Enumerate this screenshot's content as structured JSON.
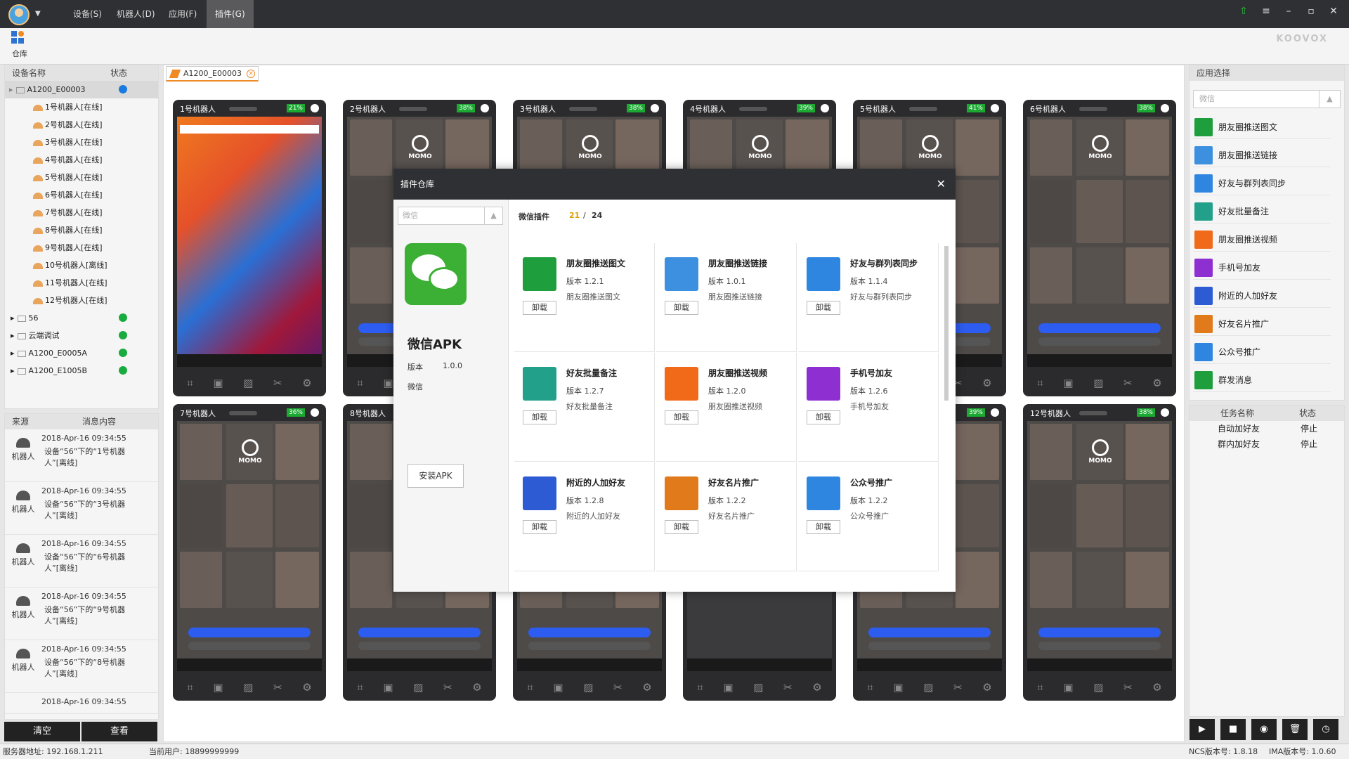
{
  "menu": [
    "设备(S)",
    "机器人(D)",
    "应用(F)",
    "插件(G)"
  ],
  "warehouse_label": "仓库",
  "brand": "KOOVOX",
  "device_panel": {
    "col_name": "设备名称",
    "col_status": "状态",
    "root": "A1200_E00003",
    "robots": [
      "1号机器人[在线]",
      "2号机器人[在线]",
      "3号机器人[在线]",
      "4号机器人[在线]",
      "5号机器人[在线]",
      "6号机器人[在线]",
      "7号机器人[在线]",
      "8号机器人[在线]",
      "9号机器人[在线]",
      "10号机器人[离线]",
      "11号机器人[在线]",
      "12号机器人[在线]"
    ],
    "groups": [
      "56",
      "云端调试",
      "A1200_E0005A",
      "A1200_E1005B"
    ]
  },
  "msg_panel": {
    "col_src": "来源",
    "col_msg": "消息内容",
    "items": [
      {
        "src": "机器人",
        "time": "2018-Apr-16 09:34:55",
        "body": "设备“56”下的“1号机器人”[离线]"
      },
      {
        "src": "机器人",
        "time": "2018-Apr-16 09:34:55",
        "body": "设备“56”下的“3号机器人”[离线]"
      },
      {
        "src": "机器人",
        "time": "2018-Apr-16 09:34:55",
        "body": "设备“56”下的“6号机器人”[离线]"
      },
      {
        "src": "机器人",
        "time": "2018-Apr-16 09:34:55",
        "body": "设备“56”下的“9号机器人”[离线]"
      },
      {
        "src": "机器人",
        "time": "2018-Apr-16 09:34:55",
        "body": "设备“56”下的“8号机器人”[离线]"
      },
      {
        "src": "",
        "time": "2018-Apr-16 09:34:55",
        "body": ""
      }
    ],
    "btn_clear": "清空",
    "btn_view": "查看"
  },
  "center_tab": "A1200_E00003",
  "phones": [
    {
      "name": "1号机器人",
      "batt": "21%"
    },
    {
      "name": "2号机器人",
      "batt": "38%"
    },
    {
      "name": "3号机器人",
      "batt": "38%"
    },
    {
      "name": "4号机器人",
      "batt": "39%"
    },
    {
      "name": "5号机器人",
      "batt": "41%"
    },
    {
      "name": "6号机器人",
      "batt": "38%"
    },
    {
      "name": "7号机器人",
      "batt": "36%"
    },
    {
      "name": "8号机器人",
      "batt": ""
    },
    {
      "name": "",
      "batt": ""
    },
    {
      "name": "",
      "batt": ""
    },
    {
      "name": "",
      "batt": "39%"
    },
    {
      "name": "12号机器人",
      "batt": "38%"
    }
  ],
  "momo_label": "MOMO",
  "app_panel": {
    "title": "应用选择",
    "select": "微信",
    "apps": [
      "朋友圈推送图文",
      "朋友圈推送链接",
      "好友与群列表同步",
      "好友批量备注",
      "朋友圈推送视频",
      "手机号加友",
      "附近的人加好友",
      "好友名片推广",
      "公众号推广",
      "群发消息"
    ],
    "app_colors": [
      "#1e9e3c",
      "#3d8fe0",
      "#2f86e0",
      "#22a08a",
      "#f06a1a",
      "#8e2fd1",
      "#2c5bd3",
      "#e07a1a",
      "#2f86e0",
      "#1e9e3c"
    ]
  },
  "task_panel": {
    "col_name": "任务名称",
    "col_status": "状态",
    "rows": [
      {
        "name": "自动加好友",
        "status": "停止"
      },
      {
        "name": "群内加好友",
        "status": "停止"
      }
    ]
  },
  "status_bar": {
    "server": "服务器地址: 192.168.1.211",
    "user": "当前用户: 18899999999",
    "ncs": "NCS版本号: 1.8.18",
    "ima": "IMA版本号: 1.0.60"
  },
  "modal": {
    "title": "插件仓库",
    "select": "微信",
    "apk_name": "微信APK",
    "apk_ver_label": "版本",
    "apk_ver": "1.0.0",
    "apk_cat": "微信",
    "install": "安装APK",
    "section": "微信插件",
    "count_a": "21",
    "count_sep": "/",
    "count_b": "24",
    "plugins": [
      {
        "name": "朋友圈推送图文",
        "ver": "版本  1.2.1",
        "desc": "朋友圈推送图文",
        "color": "#1e9e3c"
      },
      {
        "name": "朋友圈推送链接",
        "ver": "版本  1.0.1",
        "desc": "朋友圈推送链接",
        "color": "#3d8fe0"
      },
      {
        "name": "好友与群列表同步",
        "ver": "版本  1.1.4",
        "desc": "好友与群列表同步",
        "color": "#2f86e0"
      },
      {
        "name": "好友批量备注",
        "ver": "版本  1.2.7",
        "desc": "好友批量备注",
        "color": "#22a08a"
      },
      {
        "name": "朋友圈推送视频",
        "ver": "版本  1.2.0",
        "desc": "朋友圈推送视频",
        "color": "#f06a1a"
      },
      {
        "name": "手机号加友",
        "ver": "版本  1.2.6",
        "desc": "手机号加友",
        "color": "#8e2fd1"
      },
      {
        "name": "附近的人加好友",
        "ver": "版本  1.2.8",
        "desc": "附近的人加好友",
        "color": "#2c5bd3"
      },
      {
        "name": "好友名片推广",
        "ver": "版本  1.2.2",
        "desc": "好友名片推广",
        "color": "#e07a1a"
      },
      {
        "name": "公众号推广",
        "ver": "版本  1.2.2",
        "desc": "公众号推广",
        "color": "#2f86e0"
      }
    ],
    "uninstall": "卸载"
  }
}
